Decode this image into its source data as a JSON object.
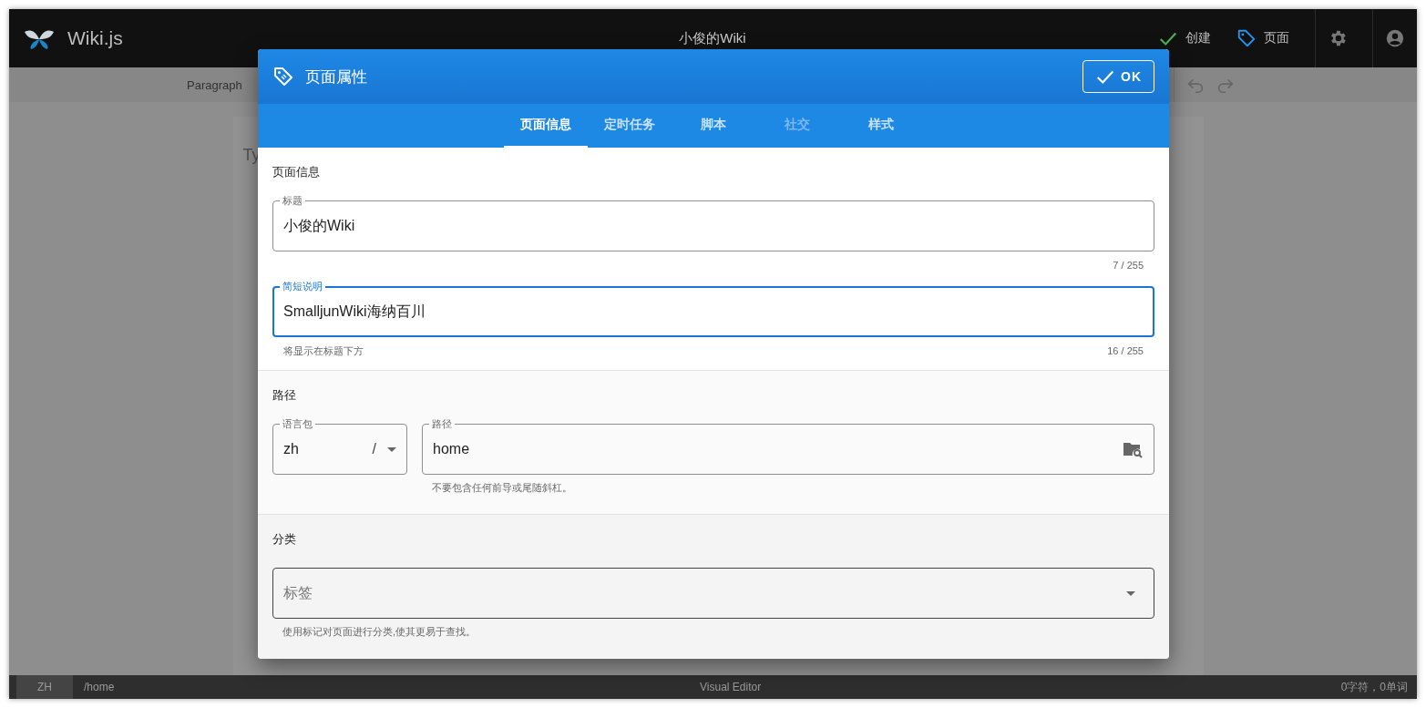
{
  "header": {
    "logo": "Wiki.js",
    "title": "小俊的Wiki",
    "actions": [
      {
        "label": "创建",
        "kind": "create"
      },
      {
        "label": "页面",
        "kind": "page"
      }
    ]
  },
  "toolbar": {
    "style": "Paragraph"
  },
  "editor": {
    "text": "Ty"
  },
  "dialog": {
    "title": "页面属性",
    "ok": "OK",
    "tabs": [
      {
        "label": "页面信息",
        "selected": true,
        "disabled": false
      },
      {
        "label": "定时任务",
        "selected": false,
        "disabled": false
      },
      {
        "label": "脚本",
        "selected": false,
        "disabled": false
      },
      {
        "label": "社交",
        "selected": false,
        "disabled": true
      },
      {
        "label": "样式",
        "selected": false,
        "disabled": false
      }
    ],
    "info": {
      "heading": "页面信息",
      "fields": [
        {
          "label": "标题",
          "value": "小俊的Wiki",
          "counter": "7 / 255",
          "focused": false
        },
        {
          "label": "简短说明",
          "value": "SmalljunWiki海纳百川",
          "hint": "将显示在标题下方",
          "counter": "16 / 255",
          "focused": true
        }
      ]
    },
    "path": {
      "heading": "路径",
      "locale": {
        "label": "语言包",
        "value": "zh",
        "separator": "/"
      },
      "path": {
        "label": "路径",
        "value": "home",
        "hint": "不要包含任何前导或尾随斜杠。"
      }
    },
    "categories": {
      "heading": "分类",
      "tags": {
        "placeholder": "标签",
        "hint": "使用标记对页面进行分类,使其更易于查找。"
      }
    }
  },
  "status_bar": {
    "locale": "ZH",
    "path": "/home",
    "mode": "Visual Editor",
    "counts": "0字符，0单词"
  }
}
